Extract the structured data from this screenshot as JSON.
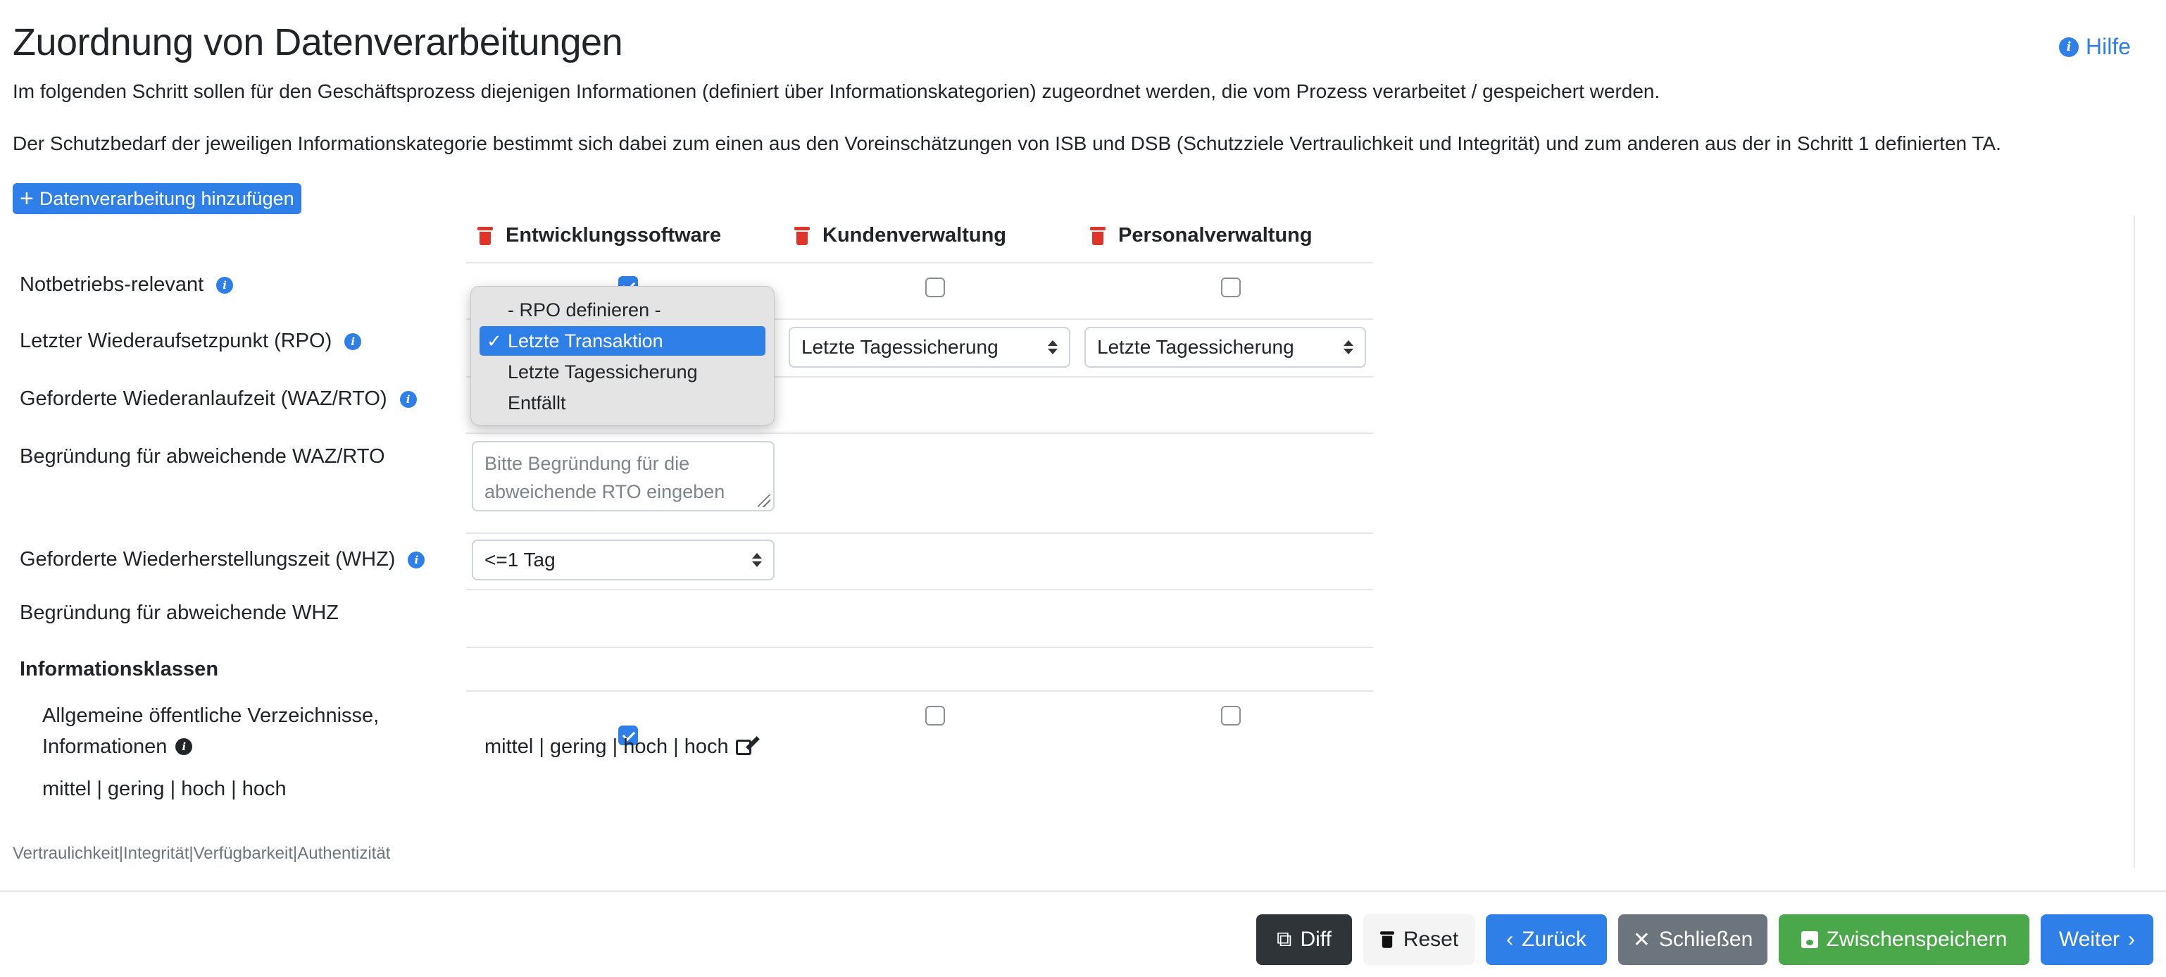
{
  "page": {
    "title": "Zuordnung von Datenverarbeitungen",
    "help_label": "Hilfe",
    "intro1": "Im folgenden Schritt sollen für den Geschäftsprozess diejenigen Informationen (definiert über Informationskategorien) zugeordnet werden, die vom Prozess verarbeitet / gespeichert werden.",
    "intro2": "Der Schutzbedarf der jeweiligen Informationskategorie bestimmt sich dabei zum einen aus den Voreinschätzungen von ISB und DSB (Schutzziele Vertraulichkeit und Integrität) und zum anderen aus der in Schritt 1 definierten TA.",
    "add_button": "Datenverarbeitung hinzufügen"
  },
  "columns": [
    "Entwicklungssoftware",
    "Kundenverwaltung",
    "Personalverwaltung"
  ],
  "rows": {
    "notbetrieb": "Notbetriebs-relevant",
    "rpo": "Letzter Wiederaufsetzpunkt (RPO)",
    "rto": "Geforderte Wiederanlaufzeit (WAZ/RTO)",
    "rto_reason": "Begründung für abweichende WAZ/RTO",
    "whz": "Geforderte Wiederherstellungszeit (WHZ)",
    "whz_reason": "Begründung für abweichende WHZ",
    "info_classes": "Informationsklassen",
    "info_item_line1": "Allgemeine öffentliche Verzeichnisse,",
    "info_item_line2": "Informationen",
    "info_item_levels": "mittel | gering | hoch | hoch"
  },
  "values": {
    "rpo_col2": "Letzte Tagessicherung",
    "rpo_col3": "Letzte Tagessicherung",
    "rto_reason_placeholder": "Bitte Begründung für die abweichende RTO eingeben",
    "whz_col1": "<=1 Tag",
    "levels_col1": "mittel | gering | hoch | hoch"
  },
  "dropdown": {
    "options": [
      "- RPO definieren -",
      "Letzte Transaktion",
      "Letzte Tagessicherung",
      "Entfällt"
    ],
    "selected": "Letzte Transaktion"
  },
  "legend": "Vertraulichkeit|Integrität|Verfügbarkeit|Authentizität",
  "footer": {
    "diff": "Diff",
    "reset": "Reset",
    "back": "Zurück",
    "close": "Schließen",
    "save": "Zwischenspeichern",
    "next": "Weiter"
  },
  "colors": {
    "primary": "#2f7fe8",
    "danger": "#e0342b",
    "success": "#4aa84a",
    "secondary": "#6c757d",
    "dark": "#2f3438"
  },
  "icons": [
    "info-icon",
    "plus-icon",
    "trash-icon",
    "chevron-updown-icon",
    "checkmark-icon",
    "edit-icon",
    "copy-icon",
    "chevron-left-icon",
    "close-icon",
    "save-icon",
    "chevron-right-icon"
  ]
}
